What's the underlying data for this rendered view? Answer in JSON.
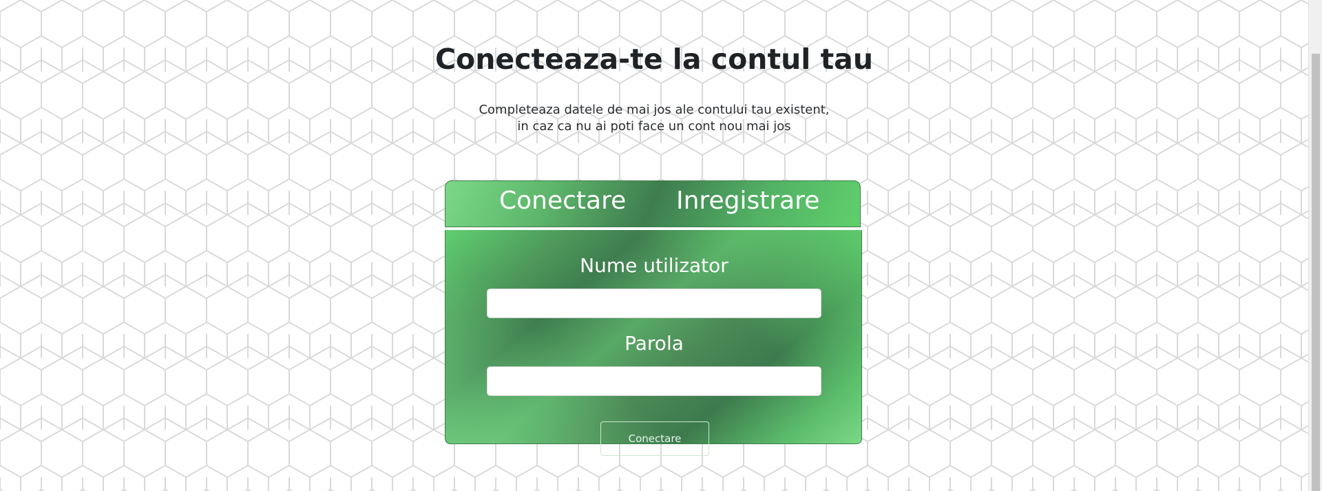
{
  "page": {
    "title": "Conecteaza-te la contul tau",
    "subtitle_line1": "Completeaza datele de mai jos ale contului tau existent,",
    "subtitle_line2": "in caz ca nu ai poti face un cont nou mai jos"
  },
  "tabs": {
    "login_label": "Conectare",
    "register_label": "Inregistrare",
    "active": "login"
  },
  "form": {
    "username_label": "Nume utilizator",
    "username_value": "",
    "password_label": "Parola",
    "password_value": "",
    "submit_label": "Conectare"
  },
  "colors": {
    "accent_green": "#52b164",
    "accent_green_dark": "#3f7d4f",
    "accent_green_light": "#7ad987",
    "text_dark": "#1f2326",
    "background": "#ffffff",
    "hex_line": "#d9d9d9"
  },
  "icons": {
    "background_pattern": "hexagon-pattern"
  }
}
